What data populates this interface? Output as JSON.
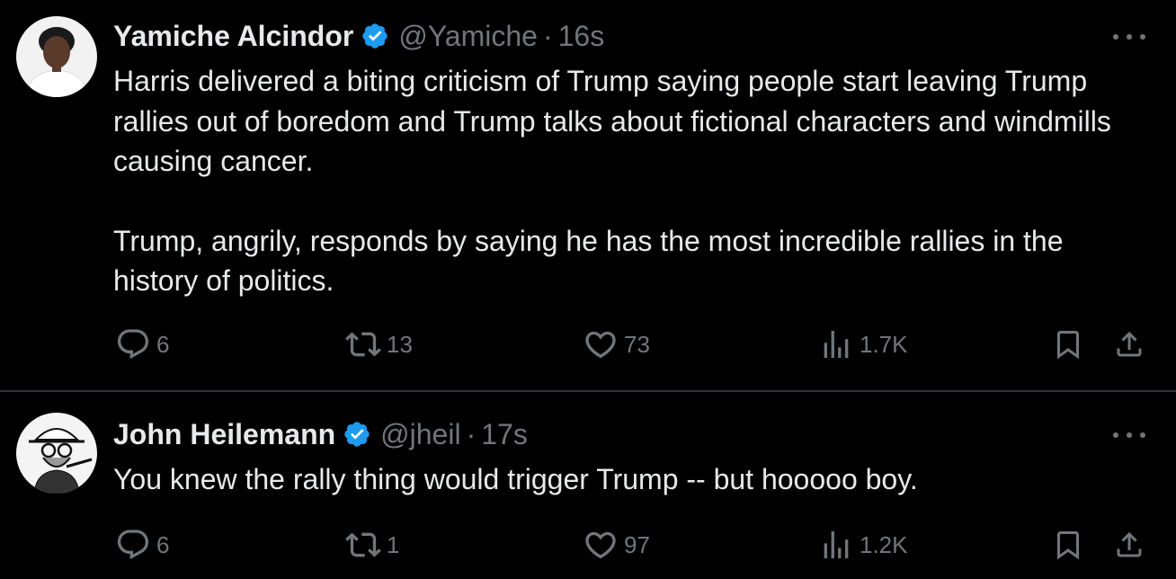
{
  "tweets": [
    {
      "author_name": "Yamiche Alcindor",
      "handle": "@Yamiche",
      "separator": "·",
      "time": "16s",
      "avatar": "profile-photo",
      "text_paragraphs": [
        "Harris delivered a biting criticism of Trump saying people start leaving Trump rallies out of boredom and Trump talks about fictional characters and windmills causing cancer.",
        "Trump, angrily, responds by saying he has the most incredible rallies in the history of politics."
      ],
      "replies": "6",
      "retweets": "13",
      "likes": "73",
      "views": "1.7K"
    },
    {
      "author_name": "John Heilemann",
      "handle": "@jheil",
      "separator": "·",
      "time": "17s",
      "avatar": "illustrated-portrait",
      "text_paragraphs": [
        "You knew the rally thing would trigger Trump -- but hooooo boy."
      ],
      "replies": "6",
      "retweets": "1",
      "likes": "97",
      "views": "1.2K"
    }
  ],
  "icons": {
    "reply": "reply-icon",
    "retweet": "retweet-icon",
    "like": "heart-icon",
    "views": "views-icon",
    "bookmark": "bookmark-icon",
    "share": "share-icon",
    "more": "more-icon",
    "verified": "verified-badge-icon"
  },
  "colors": {
    "background": "#000000",
    "text": "#e7e9ea",
    "secondary": "#71767b",
    "verified": "#1d9bf0",
    "divider": "#2f3336"
  }
}
